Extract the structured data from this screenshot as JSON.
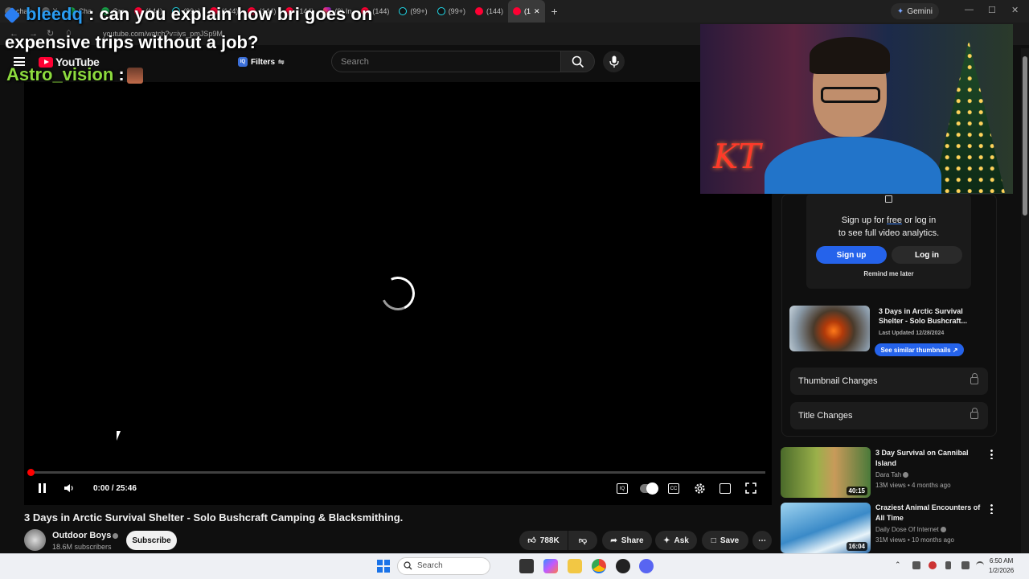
{
  "browser": {
    "tabs": [
      {
        "label": "chatt",
        "icon": "generic",
        "active": false
      },
      {
        "label": "X",
        "icon": "x",
        "active": false
      },
      {
        "label": "Cha",
        "icon": "check",
        "active": false
      },
      {
        "label": "Gro",
        "icon": "check",
        "active": false
      },
      {
        "label": "(144)",
        "icon": "youtube",
        "active": false
      },
      {
        "label": "(99+)",
        "icon": "tiktok",
        "active": false
      },
      {
        "label": "(144)",
        "icon": "youtube",
        "active": false
      },
      {
        "label": "(144)",
        "icon": "youtube",
        "active": false
      },
      {
        "label": "(144)",
        "icon": "youtube",
        "active": false
      },
      {
        "label": "(9) In",
        "icon": "instagram",
        "active": false
      },
      {
        "label": "(144)",
        "icon": "youtube",
        "active": false
      },
      {
        "label": "(99+)",
        "icon": "tiktok",
        "active": false
      },
      {
        "label": "(99+)",
        "icon": "tiktok",
        "active": false
      },
      {
        "label": "(144)",
        "icon": "youtube",
        "active": false
      },
      {
        "label": "(1",
        "icon": "youtube",
        "active": true
      }
    ],
    "new_tab": "+",
    "gemini_label": "Gemini",
    "url": "youtube.com/watch?v=iys_pmJSp9M"
  },
  "chat_overlay": {
    "msg1_user": "bleedq",
    "msg1_text_line1": ": can you explain how bri goes on",
    "msg1_text_line2": "expensive trips without a job?",
    "msg2_user": "Astro_vision",
    "msg2_sep": ":"
  },
  "youtube": {
    "logo_text": "YouTube",
    "filters_label": "Filters",
    "search_placeholder": "Search"
  },
  "player": {
    "time": "0:00 / 25:46",
    "progress": 0
  },
  "video": {
    "title": "3 Days in Arctic Survival Shelter - Solo Bushcraft Camping & Blacksmithing.",
    "channel": "Outdoor Boys",
    "subscribers": "18.6M subscribers",
    "subscribe_label": "Subscribe",
    "likes": "788K",
    "share_label": "Share",
    "ask_label": "Ask",
    "save_label": "Save"
  },
  "webcam": {
    "overlay_text": "KT"
  },
  "analytics_panel": {
    "signup_line1_pre": "Sign up for ",
    "signup_free": "free",
    "signup_line1_post": " or log in",
    "signup_line2": "to see full video analytics.",
    "signup_btn": "Sign up",
    "login_btn": "Log in",
    "remind": "Remind me later",
    "video_title": "3 Days in Arctic Survival Shelter - Solo Bushcraft...",
    "last_updated": "Last Updated 12/28/2024",
    "similar_btn": "See similar thumbnails ↗",
    "thumbnail_changes": "Thumbnail Changes",
    "title_changes": "Title Changes"
  },
  "recommendations": [
    {
      "title": "3 Day Survival on Cannibal Island",
      "channel": "Dara Tah",
      "meta": "13M views • 4 months ago",
      "duration": "40:15"
    },
    {
      "title": "Craziest Animal Encounters of All Time",
      "channel": "Daily Dose Of Internet",
      "meta": "31M views • 10 months ago",
      "duration": "16:04"
    }
  ],
  "taskbar": {
    "search_label": "Search",
    "time": "6:50 AM",
    "date": "1/2/2026"
  },
  "colors": {
    "youtube_red": "#ff0033",
    "accent_blue": "#2563eb",
    "chat_user1": "#2a9cf2",
    "chat_user2": "#8ddb3e"
  }
}
